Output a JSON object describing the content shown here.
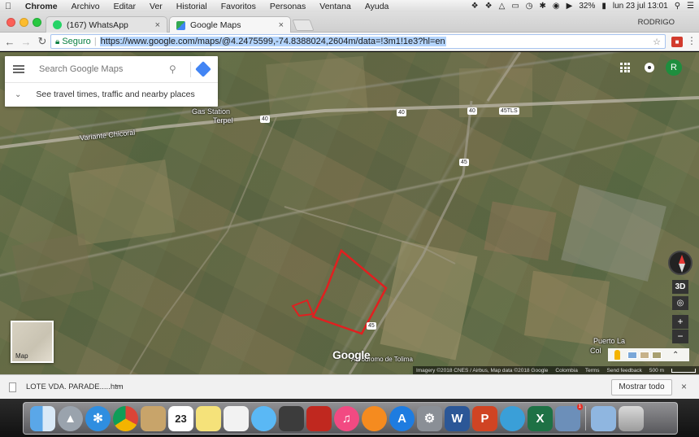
{
  "menubar": {
    "app": "Chrome",
    "items": [
      "Archivo",
      "Editar",
      "Ver",
      "Historial",
      "Favoritos",
      "Personas",
      "Ventana",
      "Ayuda"
    ],
    "battery": "32%",
    "clock": "lun 23 jul  13:01"
  },
  "tabs": [
    {
      "title": "(167) WhatsApp",
      "favicon_color": "#25d366",
      "active": false
    },
    {
      "title": "Google Maps",
      "favicon_color": "#34a853",
      "active": true
    }
  ],
  "profile": "RODRIGO",
  "toolbar": {
    "secure_label": "Seguro",
    "url": "https://www.google.com/maps/@4.2475599,-74.8388024,2604m/data=!3m1!1e3?hl=en"
  },
  "search": {
    "placeholder": "Search Google Maps",
    "directions_hint": "See travel times, traffic and nearby places"
  },
  "map": {
    "labels": {
      "gas_station": "Gas Station",
      "terpel": "Terpel",
      "variante": "Variante Chicoral",
      "puerto": "Puerto La",
      "colombia_label": "Col",
      "airport": "Aeródromo de Tolima",
      "route_40": "40",
      "route_45": "45",
      "route_45tls": "45TLS"
    },
    "layer_label": "Map",
    "logo": "Google",
    "attribution": {
      "imagery": "Imagery ©2018 CNES / Airbus, Map data ©2018 Google",
      "country": "Colombia",
      "terms": "Terms",
      "feedback": "Send feedback",
      "scale": "500 m"
    },
    "controls": {
      "tilt": "3D",
      "zoom_in": "+",
      "zoom_out": "−"
    },
    "user_initial": "R"
  },
  "downloads": {
    "file_name": "LOTE VDA. PARADE.....htm",
    "show_all": "Mostrar todo"
  },
  "dock": {
    "apps": [
      "Finder",
      "Launchpad",
      "Safari",
      "Chrome",
      "Contacts",
      "Calendar",
      "Notes",
      "Reminders",
      "Messages",
      "FaceTime",
      "Photo Booth",
      "iTunes",
      "iBooks",
      "App Store",
      "System Preferences",
      "Word",
      "PowerPoint",
      "Network",
      "Excel",
      "Preview",
      "Downloads",
      "Trash"
    ],
    "calendar_day": "23",
    "preview_badge": "1"
  },
  "colors": {
    "boundary": "#e02020",
    "highlight": "#b3d4fc",
    "secure": "#0b8043"
  }
}
